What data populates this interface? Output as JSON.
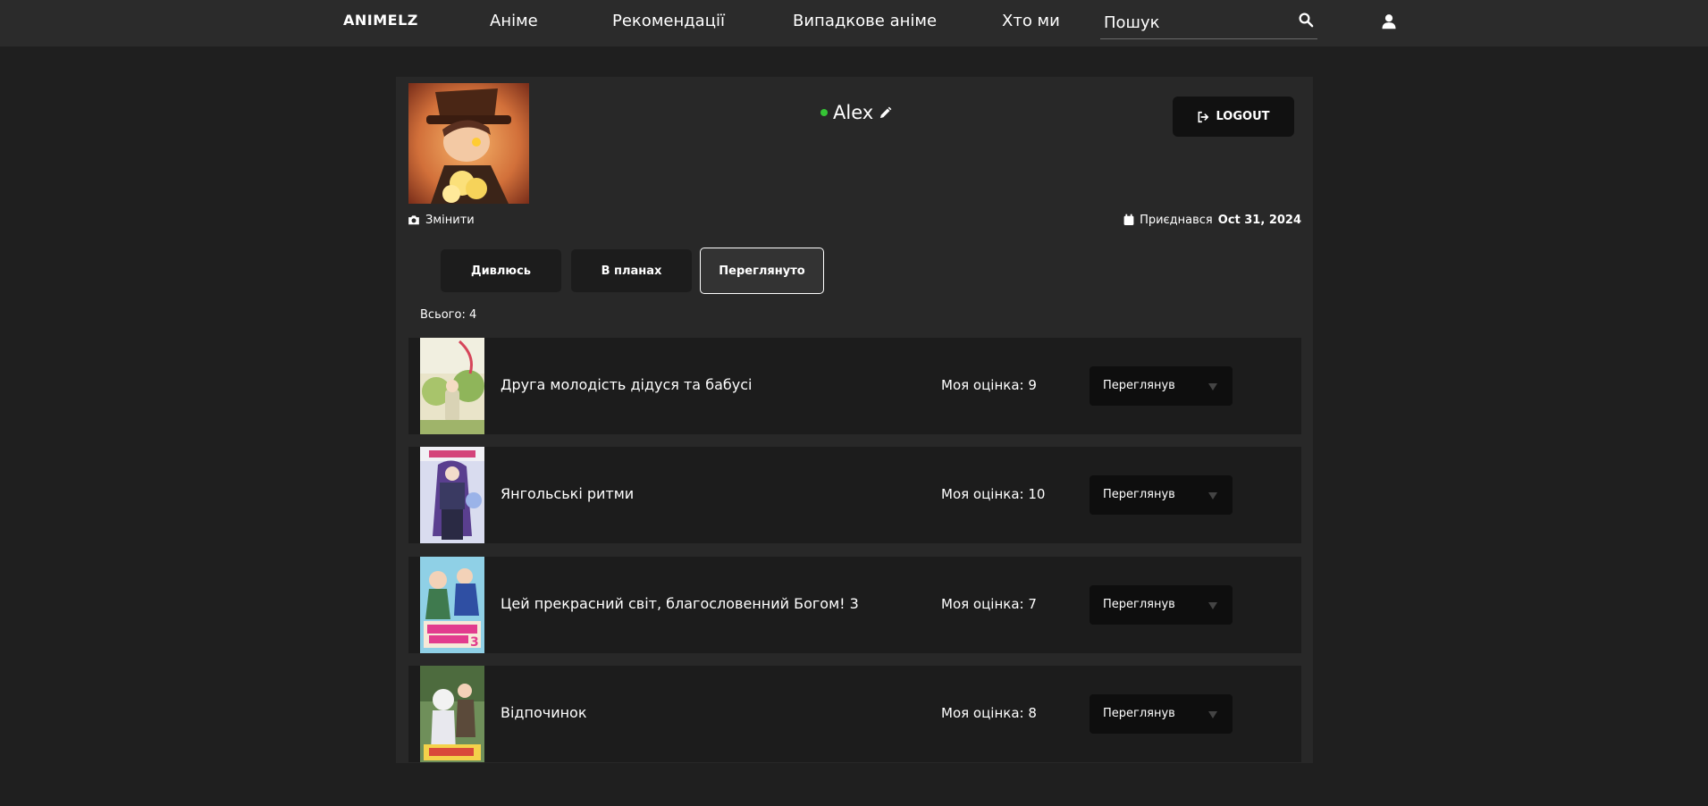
{
  "header": {
    "logo": "ANIMELZ",
    "nav": [
      "Аніме",
      "Рекомендації",
      "Випадкове аніме",
      "Хто ми"
    ],
    "search_placeholder": "Пошук"
  },
  "profile": {
    "username": "Alex",
    "online": true,
    "change_photo_label": "Змінити",
    "logout_label": "LOGOUT",
    "joined_label": "Приєднався",
    "joined_date": "Oct 31, 2024"
  },
  "tabs": [
    "Дивлюсь",
    "В планах",
    "Переглянуто"
  ],
  "active_tab": "Переглянуто",
  "total_label": "Всього: 4",
  "list": [
    {
      "title": "Друга молодість дідуся та бабусі",
      "rating": "Моя оцінка: 9",
      "status": "Переглянув"
    },
    {
      "title": "Янгольські ритми",
      "rating": "Моя оцінка: 10",
      "status": "Переглянув"
    },
    {
      "title": "Цей прекрасний світ, благословенний Богом! 3",
      "rating": "Моя оцінка: 7",
      "status": "Переглянув"
    },
    {
      "title": "Відпочинок",
      "rating": "Моя оцінка: 8",
      "status": "Переглянув"
    }
  ],
  "colors": {
    "page_bg": "#1f1f1f",
    "topbar_bg": "#2b2b2b",
    "card_bg": "#282828",
    "row_bg": "#1c1c1c",
    "online": "#35c435"
  },
  "icons": [
    "search-icon",
    "user-icon",
    "camera-icon",
    "pencil-icon",
    "logout-icon",
    "calendar-icon",
    "chevron-down-icon"
  ]
}
